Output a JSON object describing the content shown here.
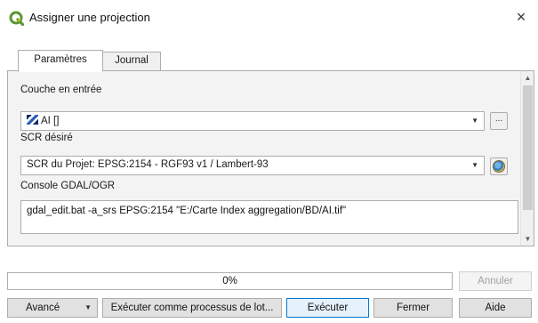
{
  "window": {
    "title": "Assigner une projection",
    "close_glyph": "×"
  },
  "tabs": [
    {
      "label": "Paramètres",
      "active": true
    },
    {
      "label": "Journal",
      "active": false
    }
  ],
  "params": {
    "input_layer": {
      "label": "Couche en entrée",
      "value": "AI []",
      "icon": "raster-layer-icon",
      "browse_label": "..."
    },
    "crs": {
      "label": "SCR désiré",
      "value": "SCR du Projet: EPSG:2154 - RGF93 v1 / Lambert-93",
      "icon": "crs-globe-icon"
    },
    "console": {
      "label": "Console GDAL/OGR",
      "command": "gdal_edit.bat -a_srs EPSG:2154 \"E:/Carte Index aggregation/BD/AI.tif\""
    }
  },
  "progress": {
    "value": 0,
    "text": "0%",
    "fill_color": "#06b025"
  },
  "buttons": {
    "annuler": "Annuler",
    "avance": "Avancé",
    "lot": "Exécuter comme processus de lot...",
    "executer": "Exécuter",
    "fermer": "Fermer",
    "aide": "Aide"
  },
  "colors": {
    "qgis_green": "#589632",
    "default_button_border": "#0078d7"
  }
}
